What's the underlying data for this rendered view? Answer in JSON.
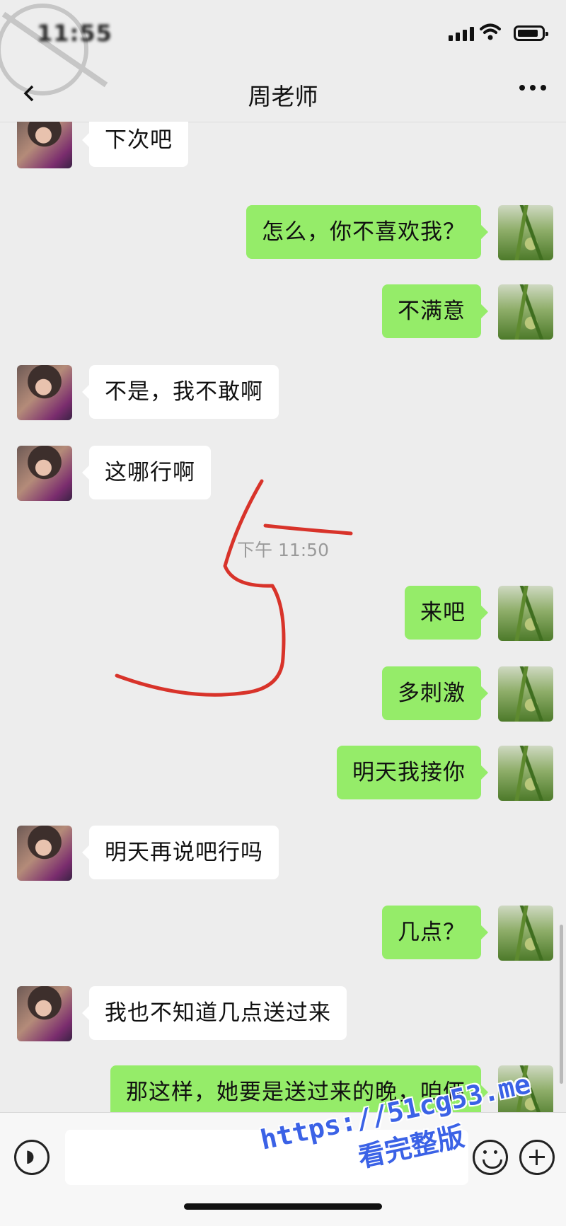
{
  "status_bar": {
    "time": "11:55"
  },
  "header": {
    "title": "周老师",
    "back_icon": "chevron-left-icon",
    "more_icon": "more-dots-icon"
  },
  "messages": [
    {
      "side": "left",
      "text": "下次吧"
    },
    {
      "side": "right",
      "text": "怎么，你不喜欢我？"
    },
    {
      "side": "right",
      "text": "不满意"
    },
    {
      "side": "left",
      "text": "不是，我不敢啊"
    },
    {
      "side": "left",
      "text": "这哪行啊"
    },
    {
      "side": "right",
      "text": "来吧"
    },
    {
      "side": "right",
      "text": "多刺激"
    },
    {
      "side": "right",
      "text": "明天我接你"
    },
    {
      "side": "left",
      "text": "明天再说吧行吗"
    },
    {
      "side": "right",
      "text": "几点？"
    },
    {
      "side": "left",
      "text": "我也不知道几点送过来"
    },
    {
      "side": "right",
      "text": "那这样，她要是送过来的晚，咱俩"
    }
  ],
  "timestamp": "下午 11:50",
  "watermark": {
    "url": "https://51cg53.me",
    "text": "看完整版"
  },
  "colors": {
    "background": "#ededed",
    "self_bubble": "#95ec69",
    "other_bubble": "#ffffff",
    "annotation": "#d8332a",
    "watermark": "#3b62e6"
  }
}
